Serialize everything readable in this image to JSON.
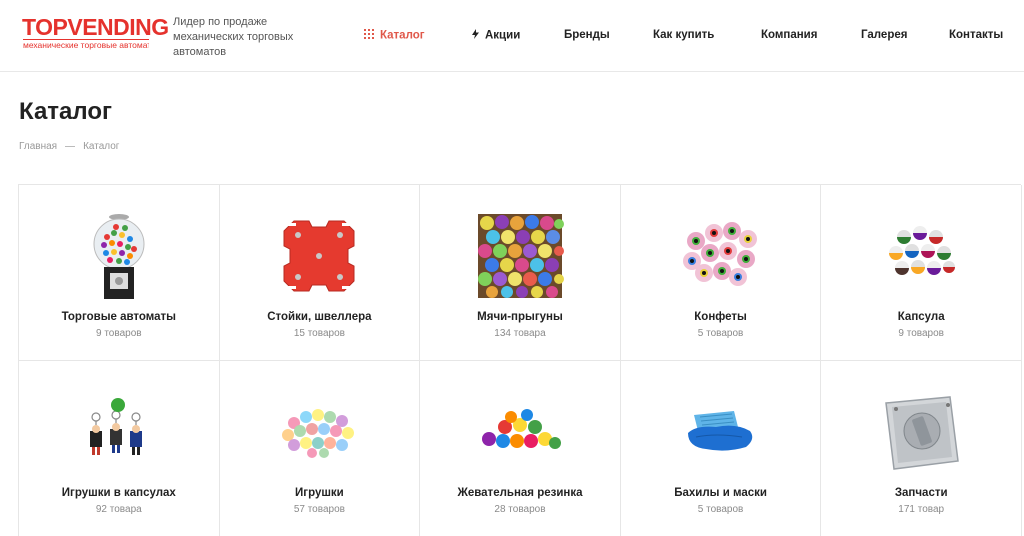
{
  "header": {
    "logo_text": "TOPVENDING",
    "logo_subtext": "механические торговые автоматы",
    "tagline": "Лидер по продаже механических торговых автоматов"
  },
  "nav": {
    "items": [
      {
        "label": "Каталог",
        "icon": "grid-icon",
        "active": true
      },
      {
        "label": "Акции",
        "icon": "lightning-icon",
        "active": false
      },
      {
        "label": "Бренды",
        "active": false
      },
      {
        "label": "Как купить",
        "active": false
      },
      {
        "label": "Компания",
        "active": false
      },
      {
        "label": "Галерея",
        "active": false
      },
      {
        "label": "Контакты",
        "active": false
      }
    ]
  },
  "page": {
    "title": "Каталог",
    "breadcrumb": [
      "Главная",
      "Каталог"
    ]
  },
  "categories": [
    {
      "name": "Торговые автоматы",
      "count": "9 товаров",
      "image": "gumball-machine-image"
    },
    {
      "name": "Стойки, швеллера",
      "count": "15 товаров",
      "image": "stand-image"
    },
    {
      "name": "Мячи-прыгуны",
      "count": "134 товара",
      "image": "bouncy-balls-image"
    },
    {
      "name": "Конфеты",
      "count": "5 товаров",
      "image": "candies-image"
    },
    {
      "name": "Капсула",
      "count": "9 товаров",
      "image": "capsules-image"
    },
    {
      "name": "Игрушки в капсулах",
      "count": "92 товара",
      "image": "keychains-image"
    },
    {
      "name": "Игрушки",
      "count": "57 товаров",
      "image": "toys-image"
    },
    {
      "name": "Жевательная резинка",
      "count": "28 товаров",
      "image": "gum-image"
    },
    {
      "name": "Бахилы и маски",
      "count": "5 товаров",
      "image": "shoe-covers-image"
    },
    {
      "name": "Запчасти",
      "count": "171 товар",
      "image": "coin-mechanism-image"
    }
  ],
  "colors": {
    "brand": "#e5322d",
    "active_nav": "#e0584a",
    "stand_red": "#e53a2f"
  }
}
